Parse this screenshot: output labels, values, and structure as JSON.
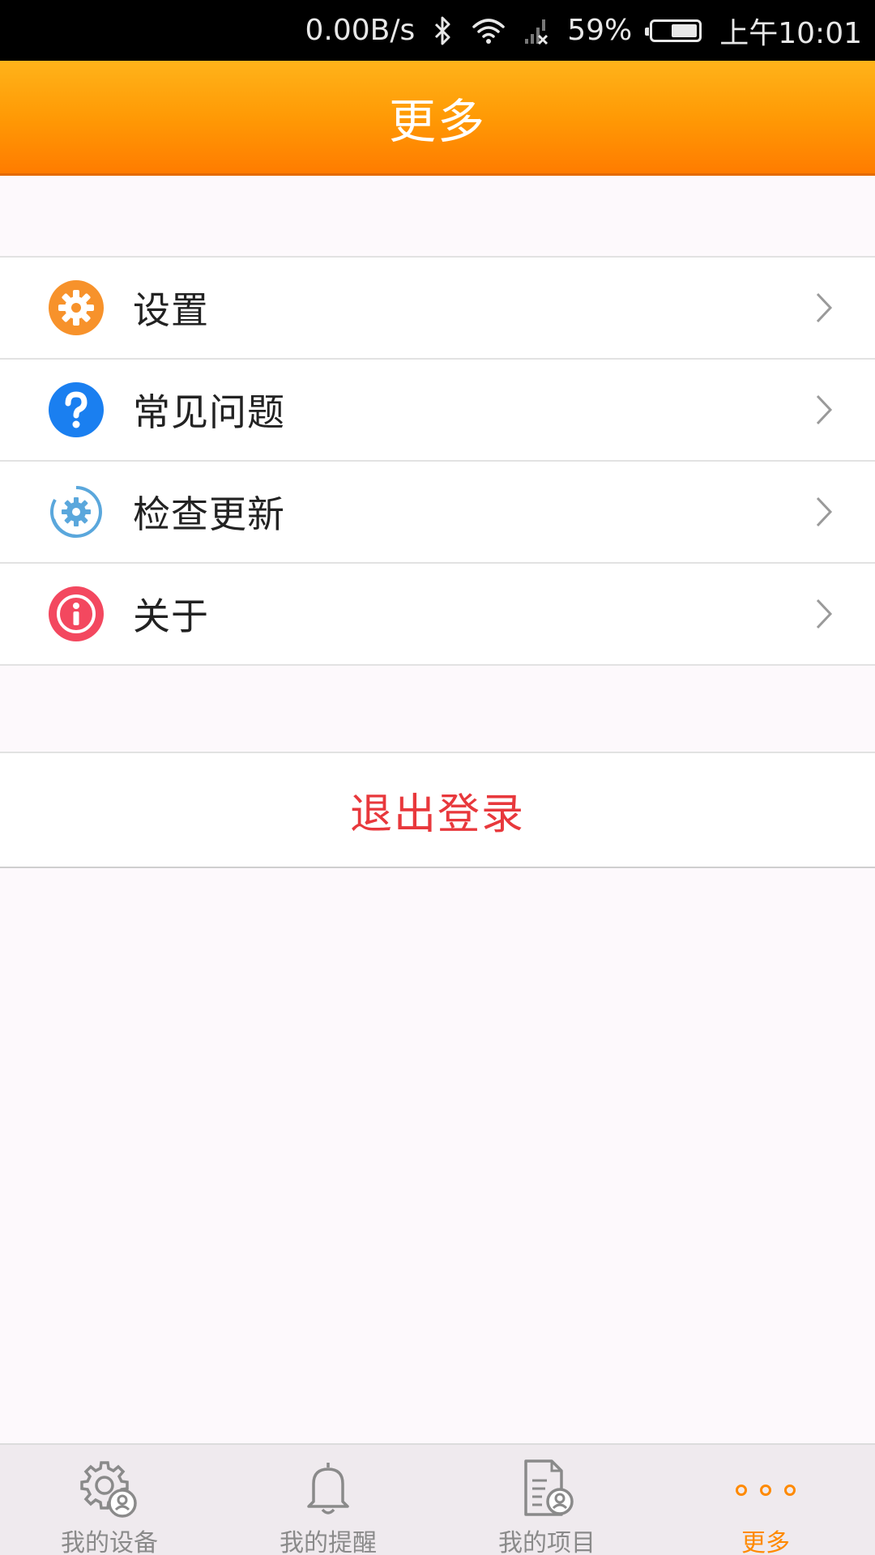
{
  "status_bar": {
    "network_speed": "0.00B/s",
    "battery_percent": "59%",
    "battery_level": 0.59,
    "time": "上午10:01",
    "icons": [
      "bluetooth-icon",
      "wifi-icon",
      "signal-icon"
    ]
  },
  "header": {
    "title": "更多"
  },
  "menu": {
    "items": [
      {
        "label": "设置",
        "icon": "gear-icon",
        "icon_color": "#f7922b"
      },
      {
        "label": "常见问题",
        "icon": "question-icon",
        "icon_color": "#1a7ff0"
      },
      {
        "label": "检查更新",
        "icon": "update-gear-icon",
        "icon_color": "#5aa7dc"
      },
      {
        "label": "关于",
        "icon": "info-icon",
        "icon_color": "#f3485f"
      }
    ]
  },
  "logout": {
    "label": "退出登录",
    "color": "#e8383c"
  },
  "bottom_nav": {
    "items": [
      {
        "label": "我的设备",
        "icon": "device-gear-icon",
        "active": false
      },
      {
        "label": "我的提醒",
        "icon": "bell-icon",
        "active": false
      },
      {
        "label": "我的项目",
        "icon": "document-icon",
        "active": false
      },
      {
        "label": "更多",
        "icon": "more-dots-icon",
        "active": true
      }
    ]
  },
  "colors": {
    "header_gradient_top": "#ffb31a",
    "header_gradient_bottom": "#ff7c00",
    "active_tab": "#ff8a00",
    "inactive_tab": "#8a8a8a"
  }
}
